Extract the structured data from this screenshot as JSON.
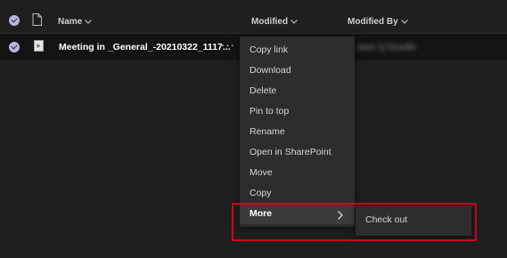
{
  "header": {
    "columns": {
      "name": "Name",
      "modified": "Modified",
      "modified_by": "Modified By"
    }
  },
  "file_row": {
    "name": "Meeting in _General_-20210322_1117...",
    "more_glyph": "···",
    "modified_by_blurred": "Jane Q Doodle"
  },
  "context_menu": {
    "items": [
      {
        "label": "Copy link"
      },
      {
        "label": "Download"
      },
      {
        "label": "Delete"
      },
      {
        "label": "Pin to top"
      },
      {
        "label": "Rename"
      },
      {
        "label": "Open in SharePoint"
      },
      {
        "label": "Move"
      },
      {
        "label": "Copy"
      },
      {
        "label": "More",
        "has_submenu": true,
        "active": true
      }
    ]
  },
  "submenu": {
    "items": [
      {
        "label": "Check out"
      }
    ]
  },
  "colors": {
    "background": "#1f1f1f",
    "menu_background": "#2d2d2d",
    "menu_active": "#3b3b3b",
    "check_accent": "#b6b6e0",
    "highlight": "#d0021b"
  },
  "icons": {
    "chevron_down": "chevron-down-icon",
    "chevron_right": "chevron-right-icon",
    "file": "file-icon",
    "document": "document-icon",
    "select_check": "check-circle-icon"
  }
}
